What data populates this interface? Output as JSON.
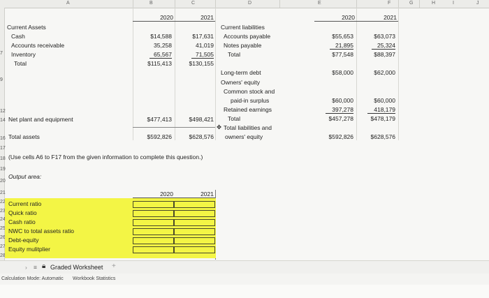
{
  "columns": [
    "A",
    "B",
    "C",
    "D",
    "E",
    "F",
    "G",
    "H",
    "I",
    "J"
  ],
  "rows": [
    "2",
    "3",
    "4",
    "5",
    "6",
    "7",
    "8",
    "9",
    "10",
    "11",
    "12",
    "13",
    "14",
    "15",
    "16",
    "17",
    "18",
    "19",
    "20",
    "21",
    "22",
    "23",
    "24",
    "25",
    "26",
    "27",
    "28",
    "29"
  ],
  "left": {
    "years": [
      "2020",
      "2021"
    ],
    "current_assets_label": "Current Assets",
    "rows": [
      {
        "label": "Cash",
        "v2020": "$14,588",
        "v2021": "$17,631"
      },
      {
        "label": "Accounts receivable",
        "v2020": "35,258",
        "v2021": "41,019"
      },
      {
        "label": "Inventory",
        "v2020": "65,567",
        "v2021": "71,505"
      },
      {
        "label": "Total",
        "v2020": "$115,413",
        "v2021": "$130,155"
      }
    ],
    "net_plant": {
      "label": "Net plant and equipment",
      "v2020": "$477,413",
      "v2021": "$498,421"
    },
    "total_assets": {
      "label": "Total assets",
      "v2020": "$592,826",
      "v2021": "$628,576"
    }
  },
  "right": {
    "years": [
      "2020",
      "2021"
    ],
    "current_liabilities_label": "Current liabilities",
    "rows": [
      {
        "label": "Accounts payable",
        "v2020": "$55,653",
        "v2021": "$63,073"
      },
      {
        "label": "Notes payable",
        "v2020": "21,895",
        "v2021": "25,324"
      },
      {
        "label": "Total",
        "v2020": "$77,548",
        "v2021": "$88,397"
      }
    ],
    "long_term_debt": {
      "label": "Long-term debt",
      "v2020": "$58,000",
      "v2021": "$62,000"
    },
    "owners_equity_label": "Owners' equity",
    "common_stock_label_1": "Common stock and",
    "common_stock_label_2": "paid-in surplus",
    "common_v2020": "$60,000",
    "common_v2021": "$60,000",
    "retained_label": "Retained earnings",
    "retained_v2020": "397,278",
    "retained_v2021": "418,179",
    "equity_total_label": "Total",
    "equity_total_v2020": "$457,278",
    "equity_total_v2021": "$478,179",
    "total_le_label_1": "Total liabilities and",
    "total_le_label_2": "owners' equity",
    "total_le_v2020": "$592,826",
    "total_le_v2021": "$628,576"
  },
  "instruction": "(Use cells A6 to F17 from the given information to complete this question.)",
  "output_label": "Output area:",
  "output_years": [
    "2020",
    "2021"
  ],
  "ratios": [
    "Current ratio",
    "Quick ratio",
    "Cash ratio",
    "NWC to total assets ratio",
    "Debt-equity",
    "Equity mulitplier"
  ],
  "sheet_tab": "Graded Worksheet",
  "add_sheet": "+",
  "status": {
    "calc_mode": "Calculation Mode: Automatic",
    "workbook_stats": "Workbook Statistics"
  }
}
